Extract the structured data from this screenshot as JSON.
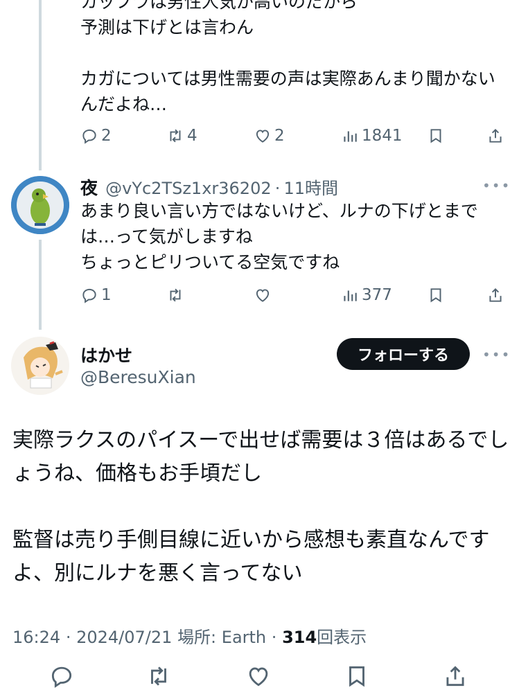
{
  "reply1": {
    "text": "カップラは男性人気が高いのだから\n予測は下げとは言わん\n\nカガについては男性需要の声は実際あんまり聞かないんだよね…",
    "replies": "2",
    "retweets": "4",
    "likes": "2",
    "views": "1841"
  },
  "reply2": {
    "name": "夜",
    "handle": "@vYc2TSz1xr36202",
    "separator": "·",
    "time": "11時間",
    "more": "•••",
    "text": "あまり良い言い方ではないけど、ルナの下げとまでは…って気がしますね\nちょっとピリついてる空気ですね",
    "replies": "1",
    "retweets": "",
    "likes": "",
    "views": "377"
  },
  "main_tweet": {
    "name": "はかせ",
    "handle": "@BeresuXian",
    "follow_label": "フォローする",
    "more": "•••",
    "text": "実際ラクスのパイスーで出せば需要は３倍はあるでしょうね、価格もお手頃だし\n\n監督は売り手側目線に近いから感想も素直なんですよ、別にルナを悪く言ってない",
    "time": "16:24",
    "date": "2024/07/21",
    "location_label": "場所: Earth",
    "views_count": "314",
    "views_label": "回表示",
    "sep": "·"
  },
  "icons": {
    "reply": "reply-icon",
    "retweet": "retweet-icon",
    "like": "heart-icon",
    "views": "views-chart-icon",
    "bookmark": "bookmark-icon",
    "share": "share-icon",
    "more": "more-icon"
  },
  "colors": {
    "text": "#0f1419",
    "muted": "#536471",
    "thread_line": "#cfd9de",
    "follow_bg": "#0f1419"
  }
}
